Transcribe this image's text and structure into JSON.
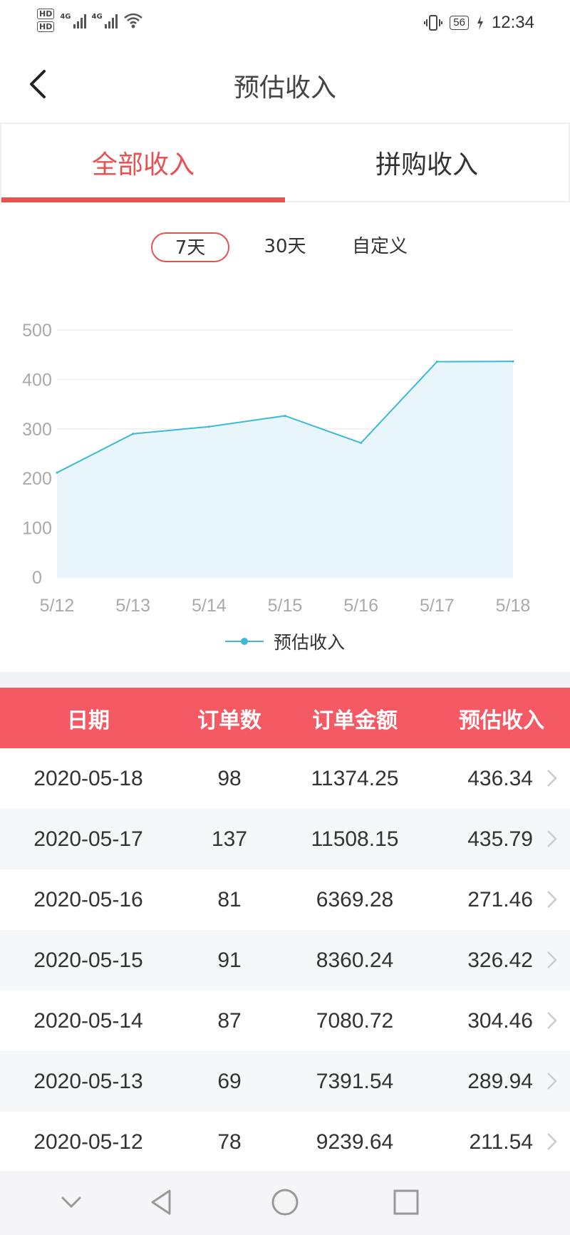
{
  "status_bar": {
    "hd1": "HD",
    "hd2": "HD",
    "net1": "4G",
    "net2": "4G",
    "battery": "56",
    "time": "12:34"
  },
  "header": {
    "title": "预估收入"
  },
  "tabs": [
    {
      "label": "全部收入",
      "active": true
    },
    {
      "label": "拼购收入",
      "active": false
    }
  ],
  "range_options": [
    {
      "label": "7天",
      "active": true
    },
    {
      "label": "30天",
      "active": false
    },
    {
      "label": "自定义",
      "active": false
    }
  ],
  "chart_data": {
    "type": "area",
    "categories": [
      "5/12",
      "5/13",
      "5/14",
      "5/15",
      "5/16",
      "5/17",
      "5/18"
    ],
    "series": [
      {
        "name": "预估收入",
        "values": [
          211.54,
          289.94,
          304.46,
          326.42,
          271.46,
          435.79,
          436.34
        ]
      }
    ],
    "yticks": [
      "0",
      "100",
      "200",
      "300",
      "400",
      "500"
    ],
    "ylim": [
      0,
      500
    ],
    "grid": true,
    "legend": "bottom-center",
    "line_color": "#3cb9d4",
    "fill_color": "#e8f6fb"
  },
  "table": {
    "headers": [
      "日期",
      "订单数",
      "订单金额",
      "预估收入"
    ],
    "header_color": "#f55a64",
    "rows": [
      [
        "2020-05-18",
        "98",
        "11374.25",
        "436.34"
      ],
      [
        "2020-05-17",
        "137",
        "11508.15",
        "435.79"
      ],
      [
        "2020-05-16",
        "81",
        "6369.28",
        "271.46"
      ],
      [
        "2020-05-15",
        "91",
        "8360.24",
        "326.42"
      ],
      [
        "2020-05-14",
        "87",
        "7080.72",
        "304.46"
      ],
      [
        "2020-05-13",
        "69",
        "7391.54",
        "289.94"
      ],
      [
        "2020-05-12",
        "78",
        "9239.64",
        "211.54"
      ]
    ]
  },
  "accent_color": "#e8514f"
}
